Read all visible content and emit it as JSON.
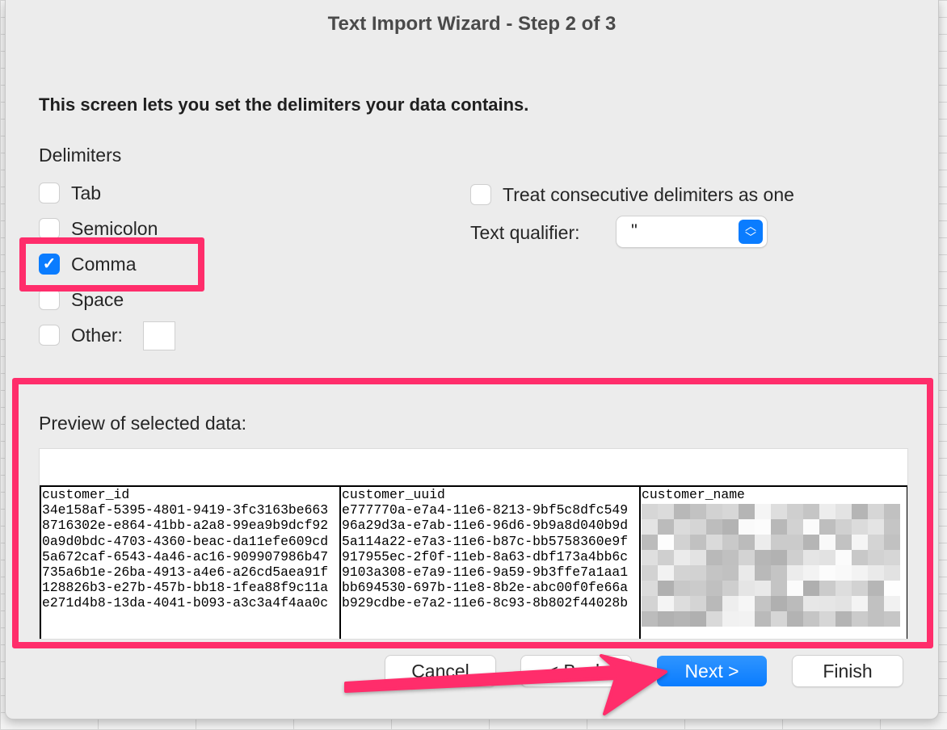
{
  "window": {
    "title": "Text Import Wizard - Step 2 of 3"
  },
  "intro": "This screen lets you set the delimiters your data contains.",
  "delimiters": {
    "label": "Delimiters",
    "items": [
      {
        "label": "Tab",
        "checked": false
      },
      {
        "label": "Semicolon",
        "checked": false
      },
      {
        "label": "Comma",
        "checked": true
      },
      {
        "label": "Space",
        "checked": false
      },
      {
        "label": "Other:",
        "checked": false,
        "value": ""
      }
    ]
  },
  "consecutive": {
    "label": "Treat consecutive delimiters as one",
    "checked": false
  },
  "qualifier": {
    "label": "Text qualifier:",
    "value": "\""
  },
  "preview": {
    "label": "Preview of selected data:",
    "columns": [
      {
        "header": "customer_id",
        "rows": [
          "34e158af-5395-4801-9419-3fc3163be663",
          "8716302e-e864-41bb-a2a8-99ea9b9dcf92",
          "0a9d0bdc-4703-4360-beac-da11efe609cd",
          "5a672caf-6543-4a46-ac16-909907986b47",
          "735a6b1e-26ba-4913-a4e6-a26cd5aea91f",
          "128826b3-e27b-457b-bb18-1fea88f9c11a",
          "e271d4b8-13da-4041-b093-a3c3a4f4aa0c"
        ]
      },
      {
        "header": "customer_uuid",
        "rows": [
          "e777770a-e7a4-11e6-8213-9bf5c8dfc549",
          "96a29d3a-e7ab-11e6-96d6-9b9a8d040b9d",
          "5a114a22-e7a3-11e6-b87c-bb5758360e9f",
          "917955ec-2f0f-11eb-8a63-dbf173a4bb6c",
          "9103a308-e7a9-11e6-9a59-9b3ffe7a1aa1",
          "bb694530-697b-11e8-8b2e-abc00f0fe66a",
          "b929cdbe-e7a2-11e6-8c93-8b802f44028b"
        ]
      },
      {
        "header": "customer_name",
        "rows": []
      }
    ]
  },
  "buttons": {
    "cancel": "Cancel",
    "back": "< Back",
    "next": "Next >",
    "finish": "Finish"
  },
  "colors": {
    "accent": "#0a7cff",
    "highlight": "#ff2d6b"
  }
}
